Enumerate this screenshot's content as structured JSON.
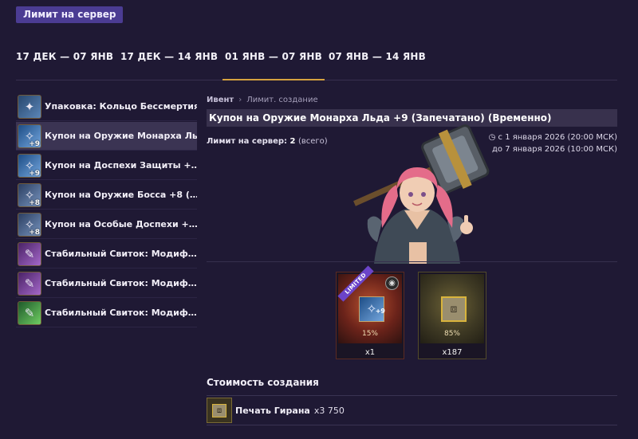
{
  "header": {
    "badge": "Лимит на сервер"
  },
  "tabs": [
    {
      "label": "17 ДЕК — 07 ЯНВ",
      "active": false
    },
    {
      "label": "17 ДЕК — 14 ЯНВ",
      "active": false
    },
    {
      "label": "01 ЯНВ — 07 ЯНВ",
      "active": true
    },
    {
      "label": "07 ЯНВ — 14 ЯНВ",
      "active": false
    }
  ],
  "sidebar": {
    "items": [
      {
        "label": "Упаковка: Кольцо Бессмертия",
        "icon": "ring-package-icon",
        "level": "",
        "active": false,
        "color": "#3a5c8c"
      },
      {
        "label": "Купон на Оружие Монарха Ль…",
        "icon": "weapon-coupon-icon",
        "level": "+9",
        "active": true,
        "color": "#35679c"
      },
      {
        "label": "Купон на Доспехи Защиты +…",
        "icon": "armor-coupon-icon",
        "level": "+9",
        "active": false,
        "color": "#35679c"
      },
      {
        "label": "Купон на Оружие Босса +8 (…",
        "icon": "boss-weapon-coupon-icon",
        "level": "+8",
        "active": false,
        "color": "#3d5a86"
      },
      {
        "label": "Купон на Особые Доспехи +…",
        "icon": "special-armor-coupon-icon",
        "level": "+8",
        "active": false,
        "color": "#3d5a86"
      },
      {
        "label": "Стабильный Свиток: Модиф…",
        "icon": "stable-scroll-purple-icon",
        "level": "",
        "active": false,
        "color": "#6a3c86"
      },
      {
        "label": "Стабильный Свиток: Модиф…",
        "icon": "stable-scroll-purple-icon",
        "level": "",
        "active": false,
        "color": "#6a3c86"
      },
      {
        "label": "Стабильный Свиток: Модиф…",
        "icon": "stable-scroll-green-icon",
        "level": "",
        "active": false,
        "color": "#3c8644"
      }
    ]
  },
  "detail": {
    "breadcrumb": {
      "root": "Ивент",
      "separator": "›",
      "current": "Лимит. создание"
    },
    "title": "Купон на Оружие Монарха Льда +9 (Запечатано) (Временно)",
    "limit_label": "Лимит на сервер:",
    "limit_value": "2",
    "limit_note": "(всего)",
    "date_from": "с 1 января 2026 (20:00 МСК)",
    "date_to": "до 7 января 2026 (10:00 МСК)",
    "hero_icon": "hammer-character-icon",
    "results": [
      {
        "badge": "LIMITED",
        "level": "+9",
        "percent": "15%",
        "qty": "x1",
        "icon": "weapon-coupon-icon"
      },
      {
        "badge": "",
        "level": "",
        "percent": "85%",
        "qty": "x187",
        "icon": "seal-box-icon"
      }
    ],
    "cost_title": "Стоимость создания",
    "cost": {
      "label": "Печать Гирана",
      "amount": "x3 750",
      "icon": "seal-box-icon"
    }
  },
  "colors": {
    "background": "#1f1934",
    "accent": "#d6a23f",
    "badge": "#4b3c93",
    "active_row": "#3b3453"
  }
}
